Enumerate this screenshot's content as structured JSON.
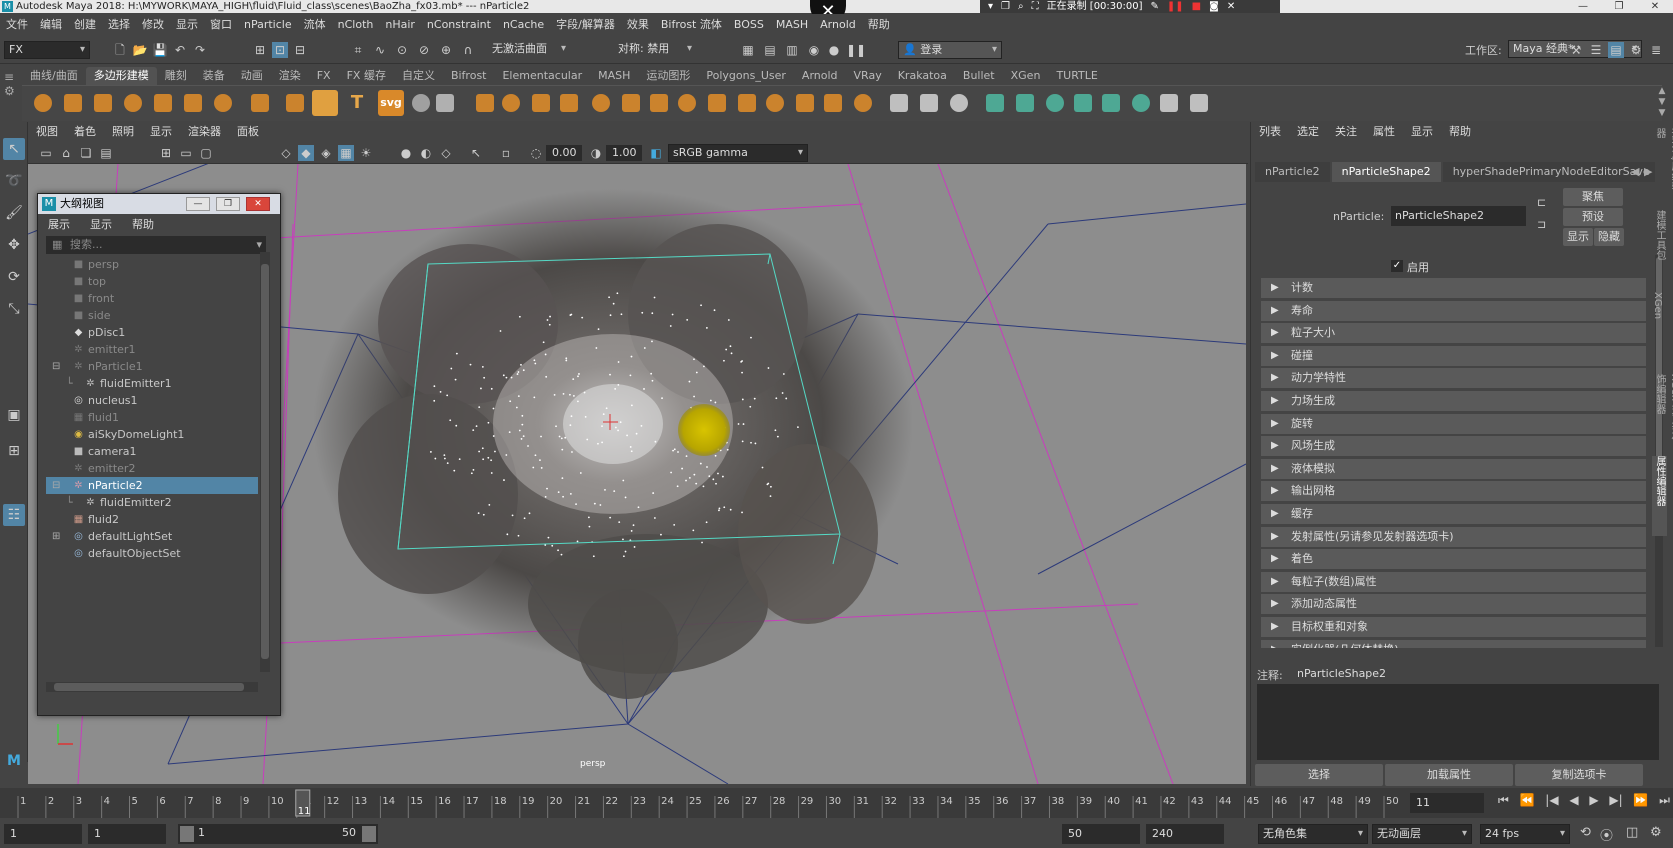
{
  "title": {
    "text": "Autodesk Maya 2018: H:\\MYWORK\\MAYA_HIGH\\fluid\\Fluid_class\\scenes\\BaoZha_fx03.mb*   ---   nParticle2",
    "logo": "maya-logo"
  },
  "recording": {
    "text": "正在录制 [00:30:00]",
    "close": "✕"
  },
  "window_controls": [
    "—",
    "❐",
    "✕"
  ],
  "menubar": [
    "文件",
    "编辑",
    "创建",
    "选择",
    "修改",
    "显示",
    "窗口",
    "nParticle",
    "流体",
    "nCloth",
    "nHair",
    "nConstraint",
    "nCache",
    "字段/解算器",
    "效果",
    "Bifrost 流体",
    "BOSS",
    "MASH",
    "Arnold",
    "帮助"
  ],
  "status": {
    "menuset": "FX",
    "objname": "无激活曲面",
    "symmetry": "对称: 禁用",
    "login": "登录",
    "workspace_label": "工作区:",
    "workspace": "Maya 经典*"
  },
  "shelf_tabs": [
    "曲线/曲面",
    "多边形建模",
    "雕刻",
    "装备",
    "动画",
    "渲染",
    "FX",
    "FX 缓存",
    "自定义",
    "Bifrost",
    "Elementacular",
    "MASH",
    "运动图形",
    "Polygons_User",
    "Arnold",
    "VRay",
    "Krakatoa",
    "Bullet",
    "XGen",
    "TURTLE"
  ],
  "shelf_active": 1,
  "shelf_text_icons": [
    "T",
    "svg"
  ],
  "viewport": {
    "menu": [
      "视图",
      "着色",
      "照明",
      "显示",
      "渲染器",
      "面板"
    ],
    "exposure": "0.00",
    "gamma": "1.00",
    "colorspace": "sRGB gamma",
    "camera": "persp"
  },
  "outliner": {
    "title": "大纲视图",
    "menu": [
      "展示",
      "显示",
      "帮助"
    ],
    "search_placeholder": "搜索...",
    "items": [
      {
        "label": "persp",
        "icon": "camera-icon",
        "dim": true,
        "indent": 1
      },
      {
        "label": "top",
        "icon": "camera-icon",
        "dim": true,
        "indent": 1
      },
      {
        "label": "front",
        "icon": "camera-icon",
        "dim": true,
        "indent": 1
      },
      {
        "label": "side",
        "icon": "camera-icon",
        "dim": true,
        "indent": 1
      },
      {
        "label": "pDisc1",
        "icon": "mesh-icon",
        "dim": false,
        "indent": 1
      },
      {
        "label": "emitter1",
        "icon": "emitter-icon",
        "dim": true,
        "indent": 1
      },
      {
        "label": "nParticle1",
        "icon": "particle-icon",
        "dim": true,
        "indent": 1,
        "expander": "⊟"
      },
      {
        "label": "fluidEmitter1",
        "icon": "emitter-icon",
        "dim": false,
        "indent": 2
      },
      {
        "label": "nucleus1",
        "icon": "nucleus-icon",
        "dim": false,
        "indent": 1
      },
      {
        "label": "fluid1",
        "icon": "fluid-icon",
        "dim": true,
        "indent": 1
      },
      {
        "label": "aiSkyDomeLight1",
        "icon": "light-icon",
        "dim": false,
        "indent": 1
      },
      {
        "label": "camera1",
        "icon": "camera-icon",
        "dim": false,
        "indent": 1
      },
      {
        "label": "emitter2",
        "icon": "emitter-icon",
        "dim": true,
        "indent": 1
      },
      {
        "label": "nParticle2",
        "icon": "particle-icon",
        "dim": false,
        "indent": 1,
        "expander": "⊟",
        "selected": true
      },
      {
        "label": "fluidEmitter2",
        "icon": "emitter-icon",
        "dim": false,
        "indent": 2
      },
      {
        "label": "fluid2",
        "icon": "fluid-icon",
        "dim": false,
        "indent": 1
      },
      {
        "label": "defaultLightSet",
        "icon": "set-icon",
        "dim": false,
        "indent": 1,
        "expander": "⊞"
      },
      {
        "label": "defaultObjectSet",
        "icon": "set-icon",
        "dim": false,
        "indent": 1
      }
    ]
  },
  "attr": {
    "menu": [
      "列表",
      "选定",
      "关注",
      "属性",
      "显示",
      "帮助"
    ],
    "tabs": [
      "nParticle2",
      "nParticleShape2",
      "hyperShadePrimaryNodeEditorSave"
    ],
    "active_tab": 1,
    "node_label": "nParticle:",
    "node_value": "nParticleShape2",
    "btn_focus": "聚焦",
    "btn_preset": "预设",
    "btn_show": "显示",
    "btn_hide": "隐藏",
    "enable_label": "启用",
    "sections": [
      "计数",
      "寿命",
      "粒子大小",
      "碰撞",
      "动力学特性",
      "力场生成",
      "旋转",
      "风场生成",
      "液体模拟",
      "输出网格",
      "缓存",
      "发射属性(另请参见发射器选项卡)",
      "着色",
      "每粒子(数组)属性",
      "添加动态属性",
      "目标权重和对象",
      "实例化器(几何体替换)"
    ],
    "notes_label": "注释:",
    "notes_value": "nParticleShape2",
    "bottom_buttons": [
      "选择",
      "加载属性",
      "复制选项卡"
    ]
  },
  "side_tabs": [
    "通道盒/层编辑器",
    "建模工具包",
    "XGen",
    "XGen 交互式修饰编辑器",
    "属性编辑器"
  ],
  "timeline": {
    "start": 1,
    "end": 50,
    "current": "11",
    "fps": "24 fps"
  },
  "range": {
    "start": "1",
    "inner_start": "1",
    "slider_start": "1",
    "slider_end": "50",
    "inner_end": "50",
    "end": "240",
    "charset": "无角色集",
    "layer": "无动画层"
  },
  "playback": [
    "⏮",
    "⏪",
    "|◀",
    "◀",
    "▶",
    "▶|",
    "⏩",
    "⏭"
  ]
}
